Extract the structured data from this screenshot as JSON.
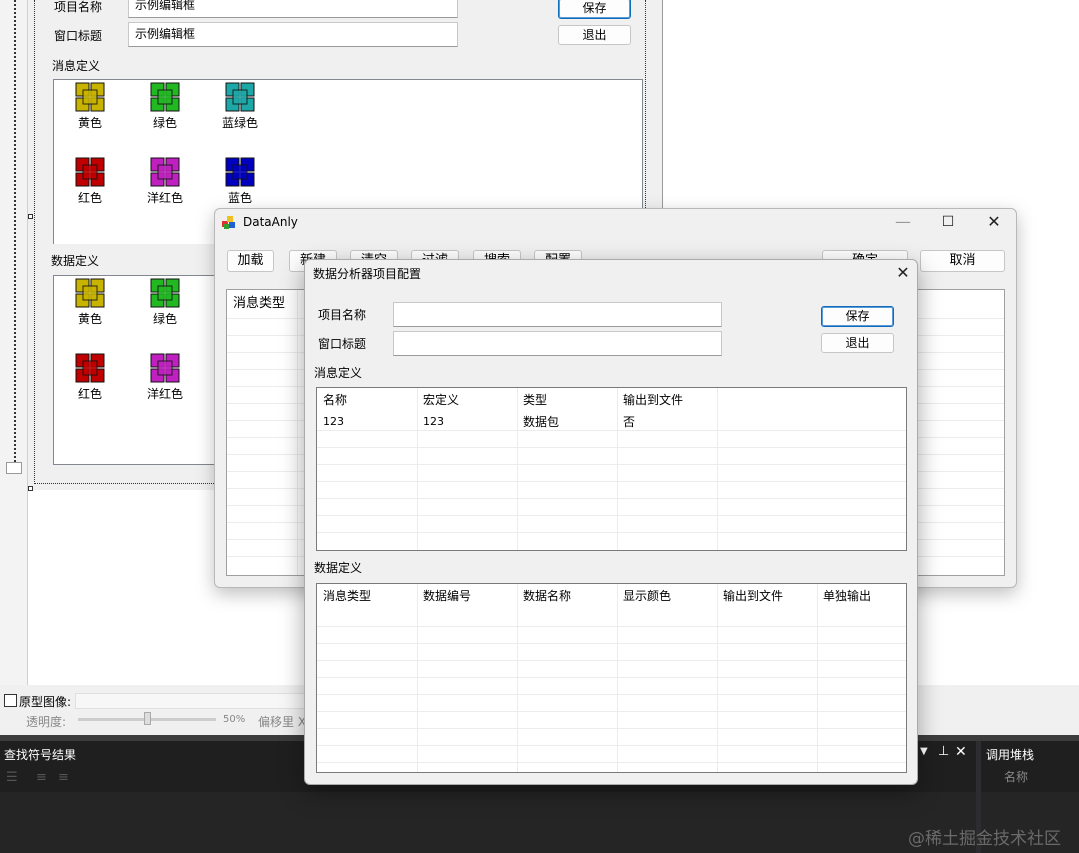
{
  "designer": {
    "project_name_label": "项目名称",
    "project_name_value": "示例编辑框",
    "window_title_label": "窗口标题",
    "window_title_value": "示例编辑框",
    "save_label": "保存",
    "exit_label": "退出",
    "message_section": "消息定义",
    "data_section": "数据定义",
    "message_icons": [
      {
        "label": "黄色",
        "color": "#c8b400"
      },
      {
        "label": "绿色",
        "color": "#22b822"
      },
      {
        "label": "蓝绿色",
        "color": "#1ea7a7"
      },
      {
        "label": "红色",
        "color": "#c00000"
      },
      {
        "label": "洋红色",
        "color": "#c020c0"
      },
      {
        "label": "蓝色",
        "color": "#0000c0"
      }
    ],
    "data_icons": [
      {
        "label": "黄色",
        "color": "#c8b400"
      },
      {
        "label": "绿色",
        "color": "#22b822"
      },
      {
        "label": "红色",
        "color": "#c00000"
      },
      {
        "label": "洋红色",
        "color": "#c020c0"
      }
    ]
  },
  "prototype": {
    "checkbox_label": "原型图像:",
    "opacity_label": "透明度:",
    "opacity_value": "50%",
    "offset_label": "偏移里 X"
  },
  "bottom_panels": {
    "find_results_title": "查找符号结果",
    "callstack_title": "调用堆栈",
    "callstack_column": "名称",
    "watermark": "@稀土掘金技术社区"
  },
  "main_window": {
    "title": "DataAnly",
    "toolbar": [
      "加载",
      "新建",
      "清空",
      "过滤",
      "搜索",
      "配置"
    ],
    "ok_label": "确定",
    "cancel_label": "取消",
    "list_header": "消息类型"
  },
  "config_dialog": {
    "title": "数据分析器项目配置",
    "project_name_label": "项目名称",
    "project_name_value": "",
    "window_title_label": "窗口标题",
    "window_title_value": "",
    "save_label": "保存",
    "exit_label": "退出",
    "message_section": "消息定义",
    "message_columns": [
      "名称",
      "宏定义",
      "类型",
      "输出到文件"
    ],
    "message_rows": [
      [
        "123",
        "123",
        "数据包",
        "否"
      ]
    ],
    "data_section": "数据定义",
    "data_columns": [
      "消息类型",
      "数据编号",
      "数据名称",
      "显示颜色",
      "输出到文件",
      "单独输出"
    ]
  }
}
